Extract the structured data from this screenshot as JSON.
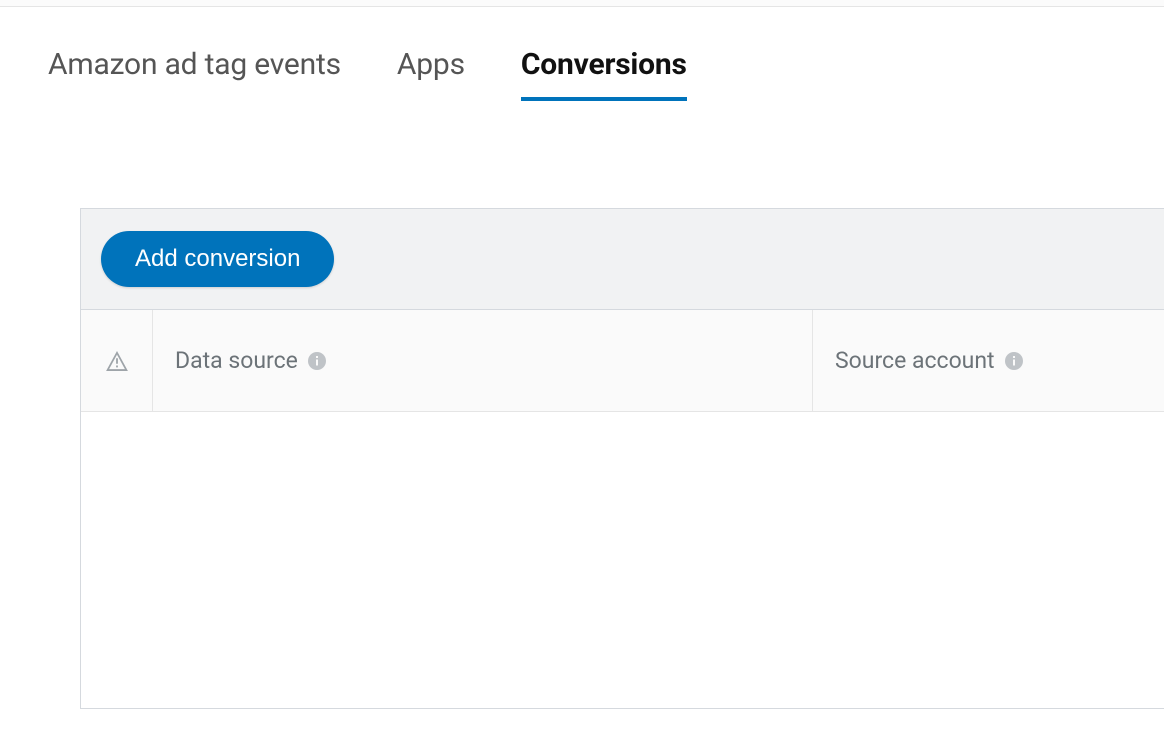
{
  "tabs": [
    {
      "label": "Amazon ad tag events",
      "active": false
    },
    {
      "label": "Apps",
      "active": false
    },
    {
      "label": "Conversions",
      "active": true
    }
  ],
  "toolbar": {
    "add_button": "Add conversion"
  },
  "table": {
    "columns": {
      "data_source": "Data source",
      "source_account": "Source account"
    },
    "rows": []
  },
  "colors": {
    "primary": "#0073bb",
    "text_muted": "#6c7378",
    "icon_muted": "#9ea4a9",
    "border": "#d5d9de"
  }
}
